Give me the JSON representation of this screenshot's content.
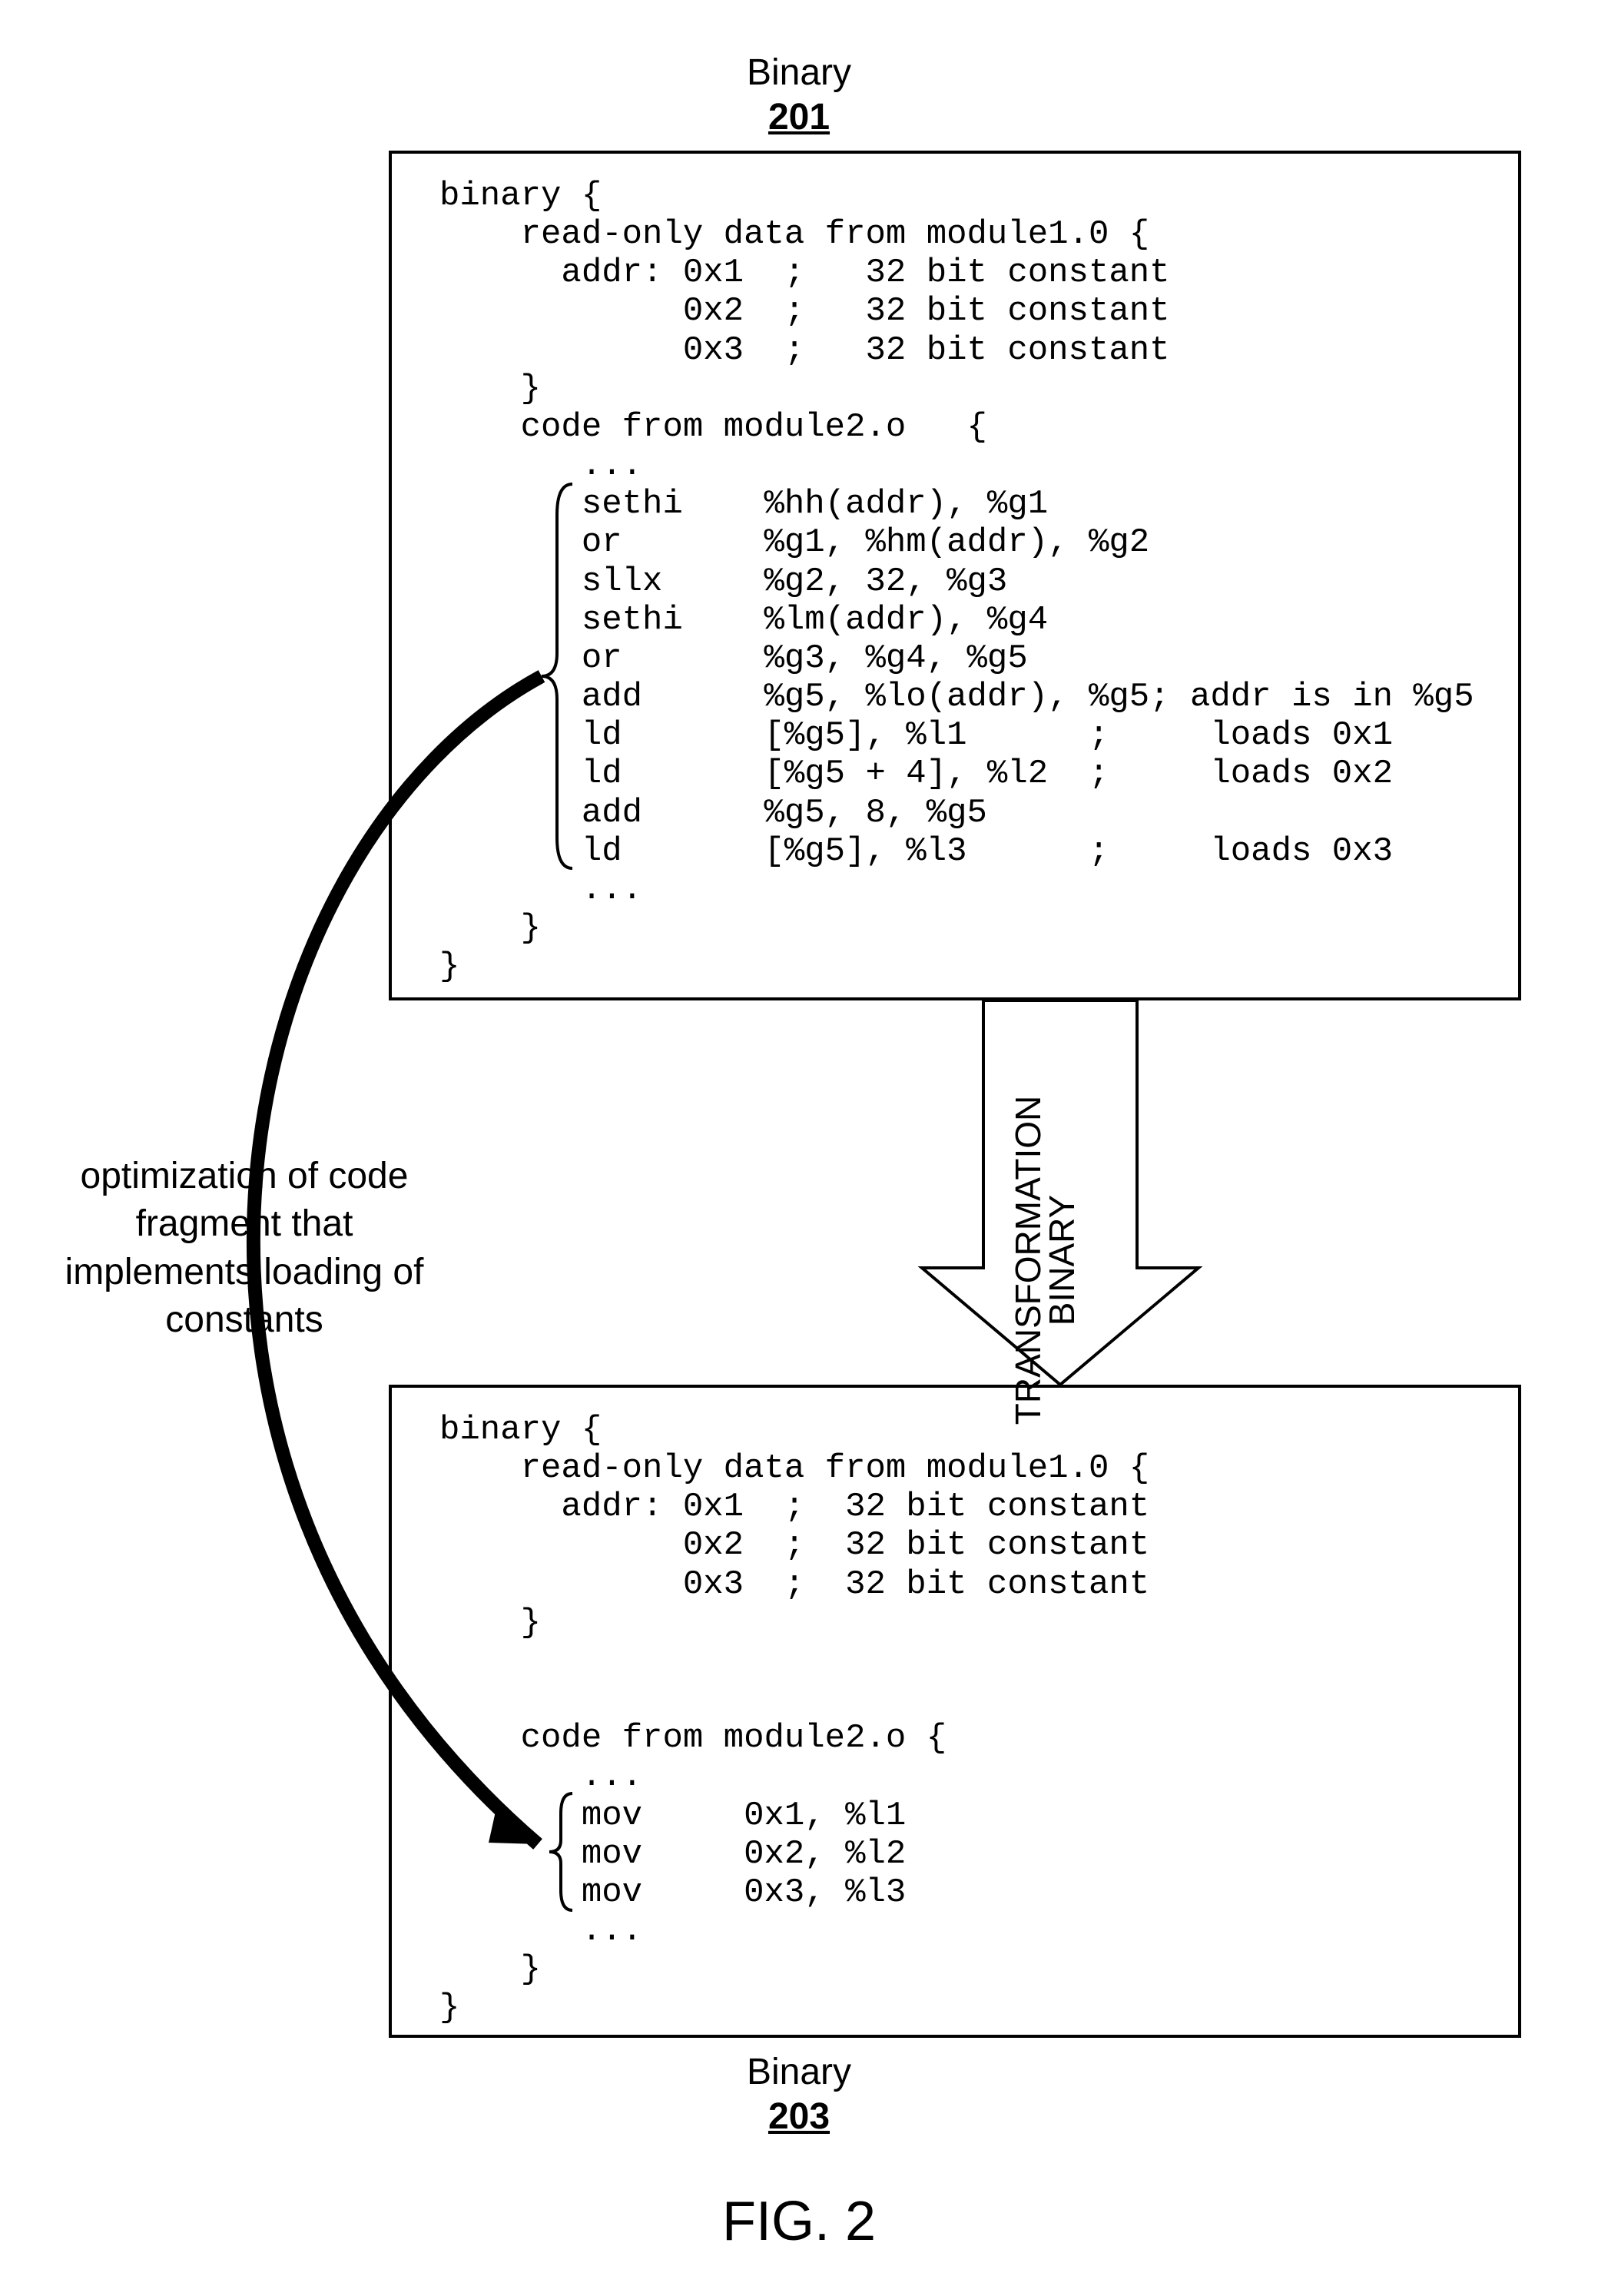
{
  "top_box": {
    "title": "Binary",
    "id": "201",
    "code": "binary {\n    read-only data from module1.0 {\n      addr: 0x1  ;   32 bit constant\n            0x2  ;   32 bit constant\n            0x3  ;   32 bit constant\n    }\n    code from module2.o   {\n       ...\n       sethi    %hh(addr), %g1\n       or       %g1, %hm(addr), %g2\n       sllx     %g2, 32, %g3\n       sethi    %lm(addr), %g4\n       or       %g3, %g4, %g5\n       add      %g5, %lo(addr), %g5; addr is in %g5\n       ld       [%g5], %l1      ;     loads 0x1\n       ld       [%g5 + 4], %l2  ;     loads 0x2\n       add      %g5, 8, %g5\n       ld       [%g5], %l3      ;     loads 0x3\n       ...\n    }\n}"
  },
  "arrow_label": "BINARY\nTRANSFORMATION",
  "annotation": "optimization of code\nfragment that\nimplements loading of\nconstants",
  "bottom_box": {
    "title": "Binary",
    "id": "203",
    "code": "binary {\n    read-only data from module1.0 {\n      addr: 0x1  ;  32 bit constant\n            0x2  ;  32 bit constant\n            0x3  ;  32 bit constant\n    }\n\n\n    code from module2.o {\n       ...\n       mov     0x1, %l1\n       mov     0x2, %l2\n       mov     0x3, %l3\n       ...\n    }\n}"
  },
  "figure_label": "FIG. 2"
}
